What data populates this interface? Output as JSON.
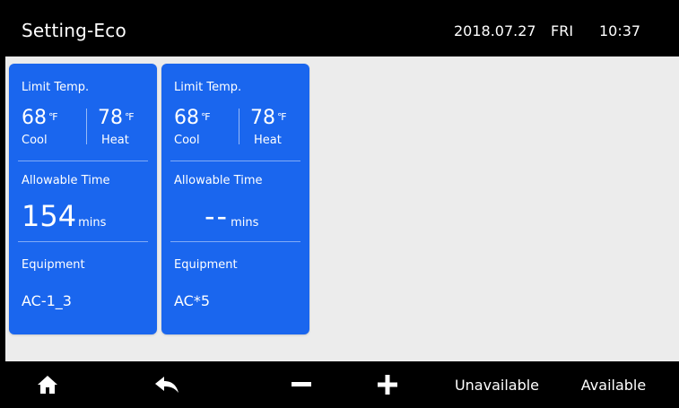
{
  "header": {
    "title": "Setting-Eco",
    "date": "2018.07.27",
    "day": "FRI",
    "time": "10:37"
  },
  "cards": [
    {
      "limit_label": "Limit Temp.",
      "cool_temp": "68",
      "heat_temp": "78",
      "temp_unit": "℉",
      "cool_label": "Cool",
      "heat_label": "Heat",
      "allowable_label": "Allowable Time",
      "allowable_value": "154",
      "allowable_unit": "mins",
      "equipment_label": "Equipment",
      "equipment_value": "AC-1_3"
    },
    {
      "limit_label": "Limit Temp.",
      "cool_temp": "68",
      "heat_temp": "78",
      "temp_unit": "℉",
      "cool_label": "Cool",
      "heat_label": "Heat",
      "allowable_label": "Allowable Time",
      "allowable_value": "--",
      "allowable_unit": "mins",
      "equipment_label": "Equipment",
      "equipment_value": "AC*5"
    }
  ],
  "toolbar": {
    "home_icon": "home-icon",
    "back_icon": "back-arrow-icon",
    "minus_icon": "minus-icon",
    "plus_icon": "plus-icon",
    "unavailable_label": "Unavailable",
    "available_label": "Available"
  },
  "colors": {
    "card_blue": "#1a66ee",
    "background": "#ececec",
    "bars": "#000000"
  }
}
